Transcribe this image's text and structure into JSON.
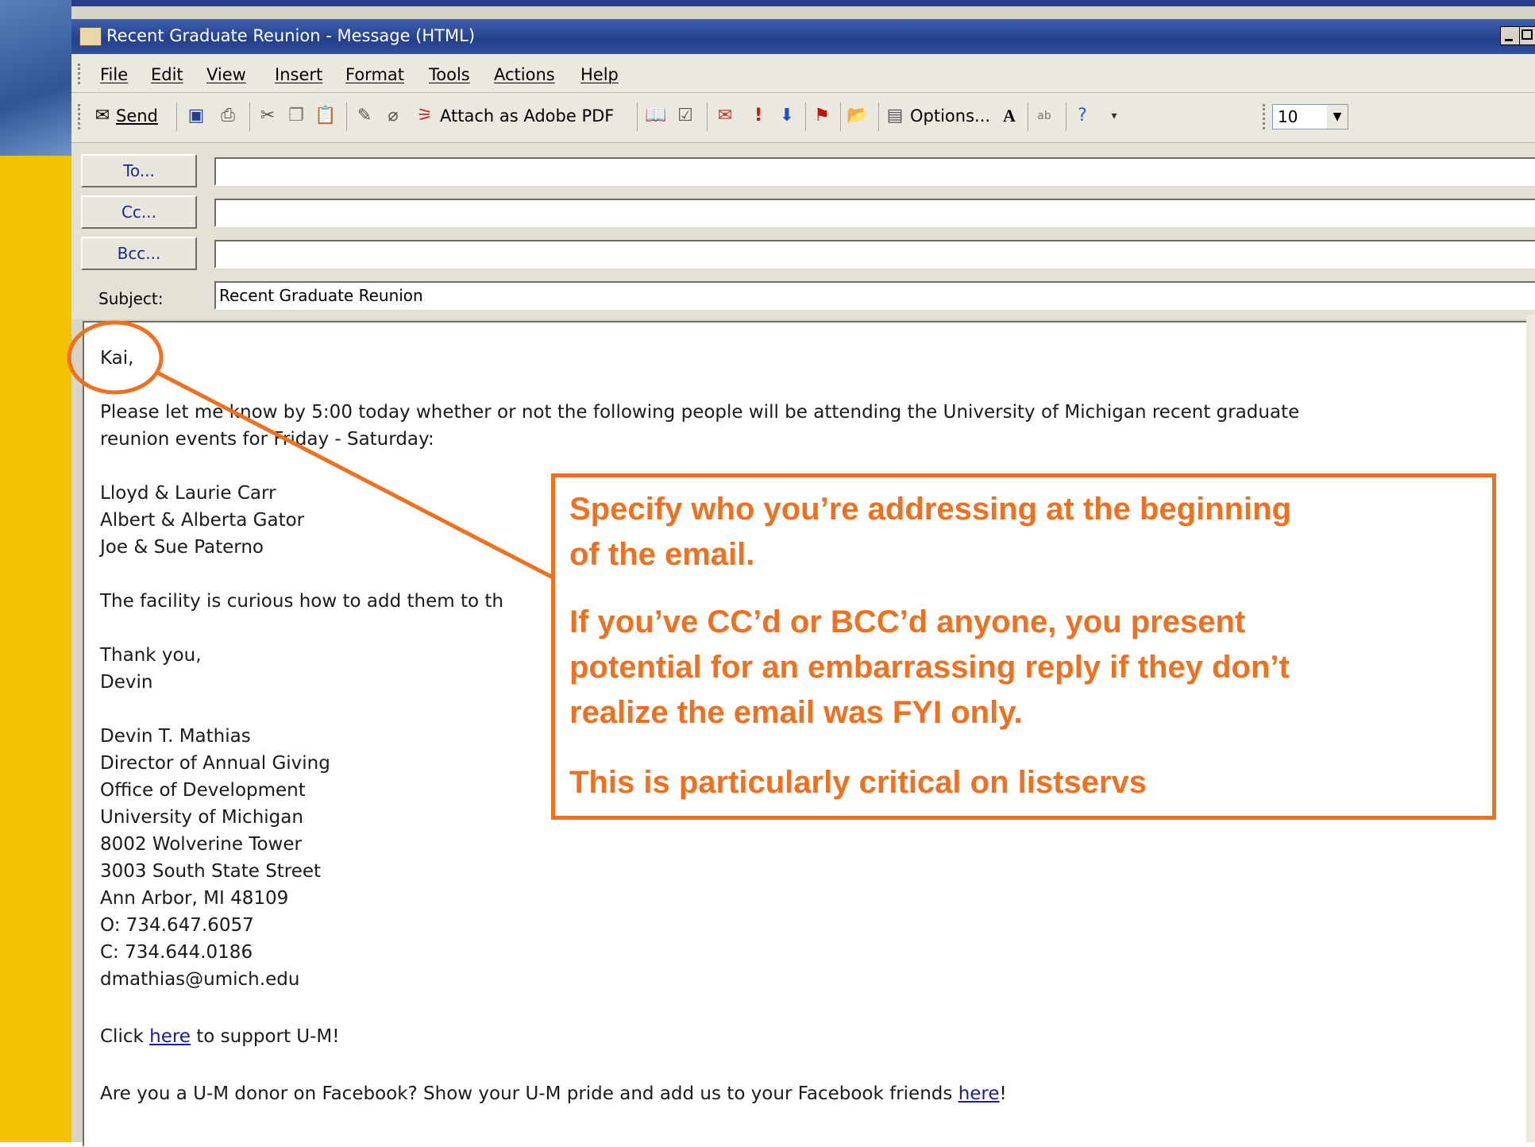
{
  "window": {
    "title": "Recent Graduate Reunion - Message (HTML)"
  },
  "menu": [
    "File",
    "Edit",
    "View",
    "Insert",
    "Format",
    "Tools",
    "Actions",
    "Help"
  ],
  "toolbar": {
    "send_label": "Send",
    "attach_pdf_label": "Attach as Adobe PDF",
    "options_label": "Options...",
    "font_size": "10"
  },
  "headers": {
    "to_label": "To...",
    "cc_label": "Cc...",
    "bcc_label": "Bcc...",
    "subject_label": "Subject:",
    "to_value": "",
    "cc_value": "",
    "bcc_value": "",
    "subject_value": "Recent Graduate Reunion"
  },
  "body": {
    "greeting": "Kai,",
    "para1_line1": "Please let me know by 5:00 today whether or not the following people will be attending the University of Michigan recent graduate",
    "para1_line2": "reunion events for Friday - Saturday:",
    "names": [
      "Lloyd & Laurie Carr",
      "Albert & Alberta Gator",
      "Joe & Sue Paterno"
    ],
    "para2": "The facility is curious how to add them to th",
    "thanks": "Thank you,",
    "sender_first": "Devin",
    "signature": [
      "Devin T. Mathias",
      "Director of Annual Giving",
      "Office of Development",
      "University of Michigan",
      "8002 Wolverine Tower",
      "3003 South State Street",
      "Ann Arbor, MI 48109",
      "O: 734.647.6057",
      "C: 734.644.0186",
      "dmathias@umich.edu"
    ],
    "support_prefix": "Click ",
    "support_link": "here",
    "support_suffix": " to support U-M!",
    "facebook_prefix": "Are you a U-M donor on Facebook?  Show your U-M pride and add us to your Facebook friends ",
    "facebook_link": "here",
    "facebook_suffix": "!"
  },
  "callout": {
    "line1": "Specify who you’re addressing at the beginning",
    "line2": "of the email.",
    "line3": "If you’ve CC’d or BCC’d anyone, you present",
    "line4": "potential for an embarrassing reply if they don’t",
    "line5": "realize the email was FYI only.",
    "line6": "This is particularly critical on listservs"
  },
  "colors": {
    "callout": "#f07020",
    "slide_sidebar": "#f2c200",
    "titlebar": "#24408a"
  }
}
